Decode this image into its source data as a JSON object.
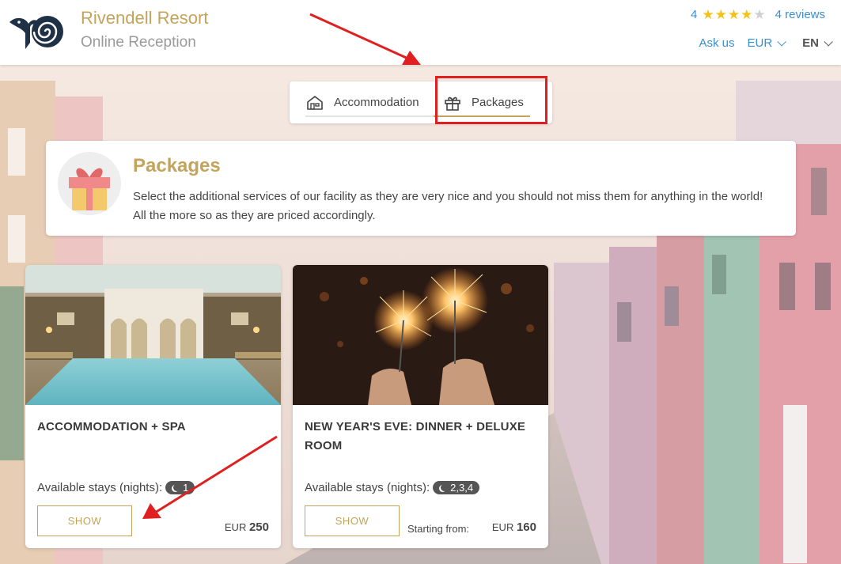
{
  "header": {
    "brand": "Rivendell Resort",
    "subtitle": "Online Reception",
    "rating_value": "4",
    "stars_filled": 4,
    "stars_total": 5,
    "reviews_link": "4 reviews",
    "ask_us": "Ask us",
    "currency": "EUR",
    "language": "EN"
  },
  "tabs": [
    {
      "label": "Accommodation",
      "icon": "house-icon",
      "active": false
    },
    {
      "label": "Packages",
      "icon": "gift-icon",
      "active": true
    }
  ],
  "intro": {
    "title": "Packages",
    "text": "Select the additional services of our facility as they are very nice and you should not miss them for anything in the world! All the more so as they are priced accordingly.",
    "icon": "gift-box-illustration"
  },
  "packages": [
    {
      "title": "ACCOMMODATION + SPA",
      "stays_label": "Available stays (nights):",
      "nights": "1",
      "button": "SHOW",
      "starting_from": "",
      "currency": "EUR",
      "price": "250",
      "image": "indoor-spa-pool"
    },
    {
      "title": "NEW YEAR'S EVE: DINNER + DELUXE ROOM",
      "stays_label": "Available stays (nights):",
      "nights": "2,3,4",
      "button": "SHOW",
      "starting_from": "Starting from:",
      "currency": "EUR",
      "price": "160",
      "image": "sparklers-celebration"
    }
  ],
  "colors": {
    "accent_gold": "#c4a35a",
    "link_blue": "#3a8fd0",
    "star_yellow": "#f2c21b",
    "annotation_red": "#e02020"
  }
}
